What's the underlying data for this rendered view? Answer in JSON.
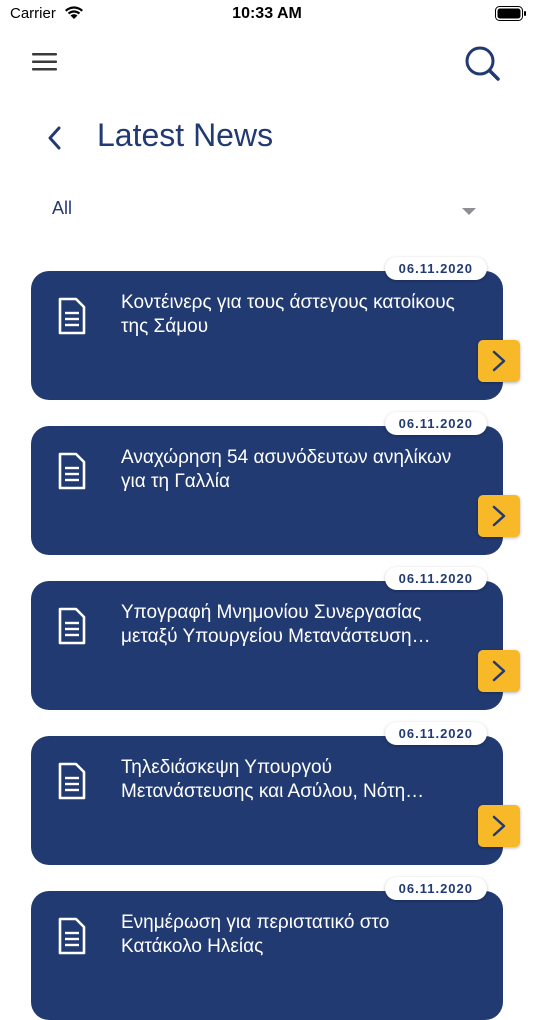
{
  "status_bar": {
    "carrier": "Carrier",
    "time": "10:33 AM"
  },
  "header": {
    "title": "Latest News",
    "menu_icon": "hamburger-menu-icon",
    "search_icon": "search-icon",
    "back_icon": "chevron-left-icon"
  },
  "filter": {
    "selected": "All"
  },
  "colors": {
    "primary": "#223a72",
    "accent": "#f7b928",
    "background": "#ffffff"
  },
  "news": [
    {
      "date": "06.11.2020",
      "title": "Κοντέινερς για τους άστεγους κατοίκους της Σάμου"
    },
    {
      "date": "06.11.2020",
      "title": "Αναχώρηση 54 ασυνόδευτων ανηλίκων για τη Γαλλία"
    },
    {
      "date": "06.11.2020",
      "title": "Υπογραφή Μνημονίου Συνεργασίας μεταξύ Υπουργείου Μετανάστευση…"
    },
    {
      "date": "06.11.2020",
      "title": "Τηλεδιάσκεψη Υπουργού Μετανάστευσης και Ασύλου, Νότη…"
    },
    {
      "date": "06.11.2020",
      "title": "Ενημέρωση για περιστατικό στο Κατάκολο Ηλείας"
    }
  ]
}
